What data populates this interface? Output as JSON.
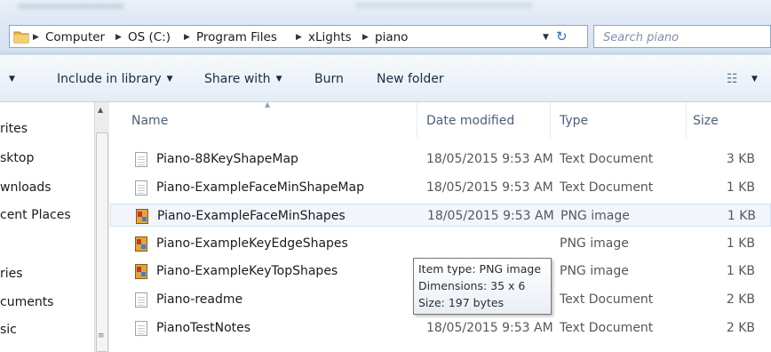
{
  "breadcrumb": [
    "Computer",
    "OS (C:)",
    "Program Files",
    "xLights",
    "piano"
  ],
  "search": {
    "placeholder": "Search piano"
  },
  "commands": {
    "include_in_library": "Include in library",
    "share_with": "Share with",
    "burn": "Burn",
    "new_folder": "New folder"
  },
  "nav": {
    "items": [
      "rites",
      "sktop",
      "wnloads",
      "cent Places",
      "ries",
      "cuments",
      "sic"
    ]
  },
  "columns": {
    "name": "Name",
    "date": "Date modified",
    "type": "Type",
    "size": "Size"
  },
  "files": [
    {
      "name": "Piano-88KeyShapeMap",
      "date": "18/05/2015 9:53 AM",
      "type": "Text Document",
      "size": "3 KB",
      "icon": "text-document-icon"
    },
    {
      "name": "Piano-ExampleFaceMinShapeMap",
      "date": "18/05/2015 9:53 AM",
      "type": "Text Document",
      "size": "1 KB",
      "icon": "text-document-icon"
    },
    {
      "name": "Piano-ExampleFaceMinShapes",
      "date": "18/05/2015 9:53 AM",
      "type": "PNG image",
      "size": "1 KB",
      "icon": "png-image-icon"
    },
    {
      "name": "Piano-ExampleKeyEdgeShapes",
      "date": "",
      "type": "PNG image",
      "size": "1 KB",
      "icon": "png-image-icon"
    },
    {
      "name": "Piano-ExampleKeyTopShapes",
      "date": "",
      "type": "PNG image",
      "size": "1 KB",
      "icon": "png-image-icon"
    },
    {
      "name": "Piano-readme",
      "date": "",
      "type": "Text Document",
      "size": "2 KB",
      "icon": "text-document-icon"
    },
    {
      "name": "PianoTestNotes",
      "date": "18/05/2015 9:53 AM",
      "type": "Text Document",
      "size": "2 KB",
      "icon": "text-document-icon"
    }
  ],
  "tooltip": {
    "item_type": "Item type: PNG image",
    "dimensions": "Dimensions: 35 x 6",
    "size": "Size: 197 bytes"
  }
}
